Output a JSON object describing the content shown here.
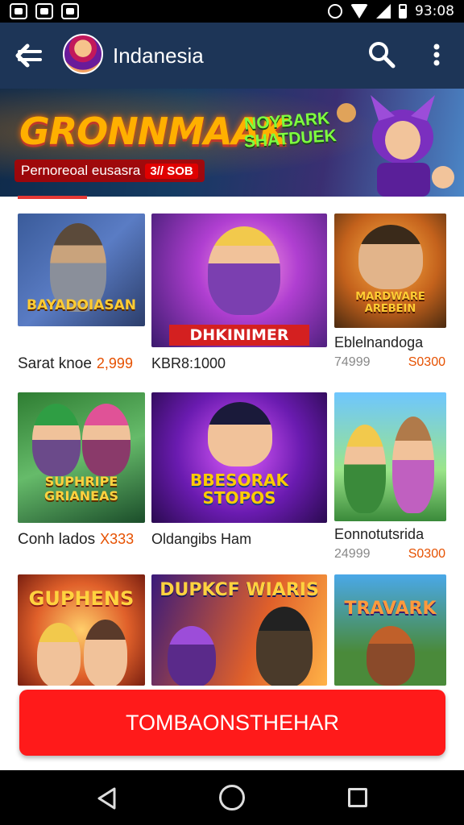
{
  "status_bar": {
    "time": "93:08",
    "icons": [
      "app-icon",
      "app-icon",
      "app-icon",
      "alarm-icon",
      "wifi-icon",
      "signal-icon",
      "battery-icon"
    ]
  },
  "app_bar": {
    "title": "Indanesia",
    "back_icon": "back-arrow-icon",
    "search_icon": "search-icon",
    "menu_icon": "more-vert-icon"
  },
  "banner": {
    "title": "GRONNMAAK",
    "badge": "NOYBARK SHATDUEK",
    "tag_text": "Pernoreoal eusasra",
    "tag_price": "3// SOB"
  },
  "cards": [
    {
      "overlay": "BAYADOIASAN",
      "name": "Sarat knoe",
      "price": "2,999"
    },
    {
      "overlay": "DHKINIMER",
      "name": "KBR8:1000",
      "price": ""
    },
    {
      "overlay": "MARDWARE AREBEIN",
      "name": "Eblelnandoga",
      "meta_left": "74999",
      "meta_right": "S0300"
    },
    {
      "overlay": "SUPHRIPE GRIANEAS",
      "name": "Conh lados",
      "price": "X333"
    },
    {
      "overlay": "BBESORAK STOPOS",
      "name": "Oldangibs Ham",
      "price": ""
    },
    {
      "overlay": "",
      "name": "Eonnotutsrida",
      "meta_left": "24999",
      "meta_right": "S0300"
    },
    {
      "overlay": "GUPHENS",
      "name": "",
      "price": ""
    },
    {
      "overlay": "DUPKCF WIARIS",
      "name": "",
      "price": ""
    },
    {
      "overlay": "TRAVARK",
      "name": "",
      "price": ""
    }
  ],
  "cta": {
    "label": "TOMBAONSTHEHAR"
  },
  "nav_bar": {
    "icons": [
      "nav-back-icon",
      "nav-home-icon",
      "nav-recent-icon"
    ]
  },
  "colors": {
    "app_bar": "#1d3557",
    "cta": "#ff1a1a",
    "price": "#e65100"
  }
}
